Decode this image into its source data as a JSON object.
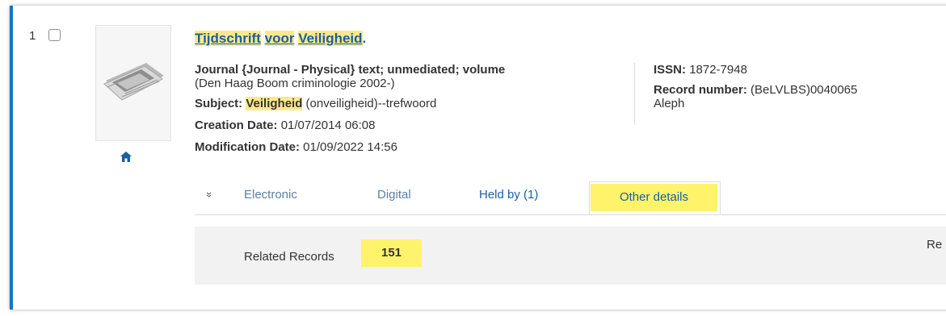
{
  "record": {
    "index": "1",
    "title_words": [
      "Tijdschrift",
      "voor",
      "Veiligheid"
    ],
    "title_suffix": ".",
    "type_line": "Journal {Journal - Physical} text; unmediated; volume",
    "publisher_line": "(Den Haag Boom criminologie 2002-)",
    "subject": {
      "label": "Subject:",
      "highlight": "Veiligheid",
      "rest": " (onveiligheid)--trefwoord"
    },
    "creation": {
      "label": "Creation Date:",
      "value": "01/07/2014 06:08"
    },
    "modification": {
      "label": "Modification Date:",
      "value": "01/09/2022 14:56"
    },
    "issn": {
      "label": "ISSN:",
      "value": "1872-7948"
    },
    "record_number": {
      "label": "Record number:",
      "value": "(BeLVLBS)0040065",
      "source": "Aleph"
    },
    "thumbnail_icon": "newspaper-icon",
    "home_icon": "home-icon"
  },
  "tabs": {
    "expand_icon": "double-chevron-down-icon",
    "expand_glyph": "»",
    "items": [
      "Electronic",
      "Digital",
      "Held by (1)",
      "Other details"
    ],
    "active": "Other details"
  },
  "details": {
    "related_label": "Related Records",
    "related_count": "151",
    "right_label": "Re"
  },
  "colors": {
    "accent": "#1b72c4",
    "link": "#1b5fa3",
    "highlight": "#fde98b",
    "marker": "#fff36b"
  }
}
